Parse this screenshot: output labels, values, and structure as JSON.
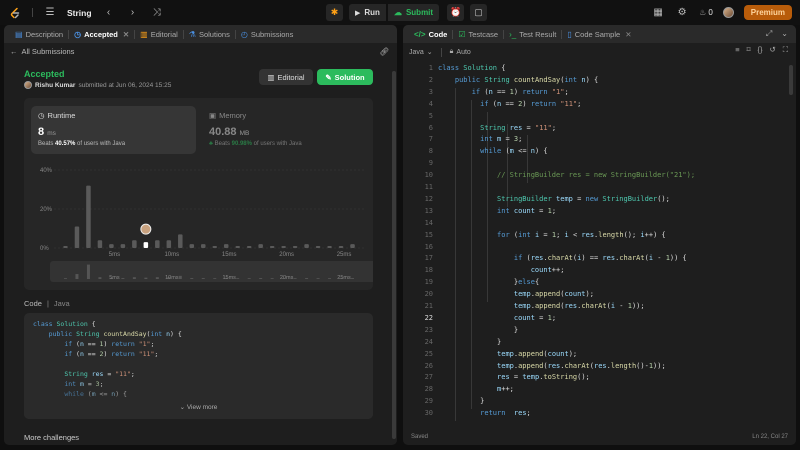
{
  "topbar": {
    "title": "String",
    "run_label": "Run",
    "submit_label": "Submit",
    "streak_count": "0",
    "premium_label": "Premium"
  },
  "left": {
    "tabs": [
      {
        "label": "Description",
        "icon": "description-icon"
      },
      {
        "label": "Accepted",
        "icon": "history-icon"
      },
      {
        "label": "Editorial",
        "icon": "book-icon"
      },
      {
        "label": "Solutions",
        "icon": "flask-icon"
      },
      {
        "label": "Submissions",
        "icon": "clock-icon"
      }
    ],
    "back_label": "All Submissions",
    "status": "Accepted",
    "user": "Rishu Kumar",
    "submitted_text": "submitted at Jun 06, 2024 15:25",
    "editorial_btn": "Editorial",
    "solution_btn": "Solution",
    "runtime": {
      "title": "Runtime",
      "value": "8",
      "unit": "ms",
      "beats_prefix": "Beats",
      "beats_value": "40.57%",
      "beats_suffix": "of users with Java"
    },
    "memory": {
      "title": "Memory",
      "value": "40.88",
      "unit": "MB",
      "beats_prefix": "Beats",
      "beats_value": "90.98%",
      "beats_suffix": "of users with Java"
    },
    "code_label": "Code",
    "code_lang": "Java",
    "view_more": "View more",
    "more_challenges": "More challenges",
    "code_preview": [
      "class Solution {",
      "    public String countAndSay(int n) {",
      "        if (n == 1) return \"1\";",
      "        if (n == 2) return \"11\";",
      "",
      "        String res = \"11\";",
      "        int m = 3;",
      "        while (m <= n) {"
    ]
  },
  "chart_data": {
    "type": "bar",
    "title": "",
    "xlabel": "",
    "ylabel": "",
    "ylim": [
      0,
      40
    ],
    "y_ticks": [
      "0%",
      "20%",
      "40%"
    ],
    "x_ticks": [
      "5ms",
      "10ms",
      "15ms",
      "20ms",
      "25ms"
    ],
    "x_tick_values": [
      5,
      10,
      15,
      20,
      25
    ],
    "bins_ms": [
      1,
      2,
      3,
      4,
      5,
      6,
      7,
      8,
      9,
      10,
      11,
      12,
      13,
      14,
      15,
      16,
      17,
      18,
      19,
      20,
      21,
      22,
      23,
      24,
      25,
      26
    ],
    "values": [
      1,
      11,
      32,
      4,
      2,
      2,
      4,
      3,
      4,
      4,
      7,
      2,
      2,
      1,
      2,
      1,
      1,
      2,
      1,
      1,
      1,
      2,
      1,
      1,
      1,
      2
    ],
    "highlight_bin_ms": 8,
    "highlight_color": "#ffffff",
    "bar_color": "#5a5a5a"
  },
  "right": {
    "tabs": [
      {
        "label": "Code",
        "icon": "code-icon"
      },
      {
        "label": "Testcase",
        "icon": "check-square-icon"
      },
      {
        "label": "Test Result",
        "icon": "terminal-icon"
      },
      {
        "label": "Code Sample",
        "icon": "file-icon"
      }
    ],
    "lang": "Java",
    "mode": "Auto",
    "status_left": "Saved",
    "status_right": "Ln 22, Col 27",
    "lines": [
      "class Solution {",
      "    public String countAndSay(int n) {",
      "        if (n == 1) return \"1\";",
      "          if (n == 2) return \"11\";",
      "",
      "          String res = \"11\";",
      "          int m = 3;",
      "          while (m <= n) {",
      "",
      "              // StringBuilder res = new StringBuilder(\"21\");",
      "",
      "              StringBuilder temp = new StringBuilder();",
      "              int count = 1;",
      "",
      "              for (int i = 1; i < res.length(); i++) {",
      "",
      "                  if (res.charAt(i) == res.charAt(i - 1)) {",
      "                      count++;",
      "                  }else{",
      "                  temp.append(count);",
      "                  temp.append(res.charAt(i - 1));",
      "                  count = 1;",
      "                  }",
      "              }",
      "              temp.append(count);",
      "              temp.append(res.charAt(res.length()-1));",
      "              res = temp.toString();",
      "              m++;",
      "          }",
      "          return  res;"
    ]
  }
}
